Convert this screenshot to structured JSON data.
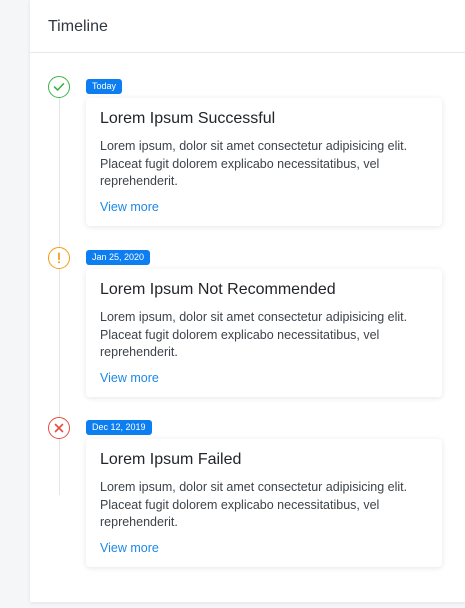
{
  "header": {
    "title": "Timeline"
  },
  "colors": {
    "success": "#3cb24a",
    "warning": "#f39c12",
    "danger": "#e74c3c",
    "badge": "#0d7df2",
    "link": "#1e88e5"
  },
  "timeline": [
    {
      "status": "success",
      "icon": "check-circle-icon",
      "date": "Today",
      "title": "Lorem Ipsum Successful",
      "body": "Lorem ipsum, dolor sit amet consectetur adipisicing elit. Placeat fugit dolorem explicabo necessitatibus, vel reprehenderit.",
      "link": "View more"
    },
    {
      "status": "warning",
      "icon": "exclamation-circle-icon",
      "date": "Jan 25, 2020",
      "title": "Lorem Ipsum Not Recommended",
      "body": "Lorem ipsum, dolor sit amet consectetur adipisicing elit. Placeat fugit dolorem explicabo necessitatibus, vel reprehenderit.",
      "link": "View more"
    },
    {
      "status": "danger",
      "icon": "x-circle-icon",
      "date": "Dec 12, 2019",
      "title": "Lorem Ipsum Failed",
      "body": "Lorem ipsum, dolor sit amet consectetur adipisicing elit. Placeat fugit dolorem explicabo necessitatibus, vel reprehenderit.",
      "link": "View more"
    }
  ]
}
